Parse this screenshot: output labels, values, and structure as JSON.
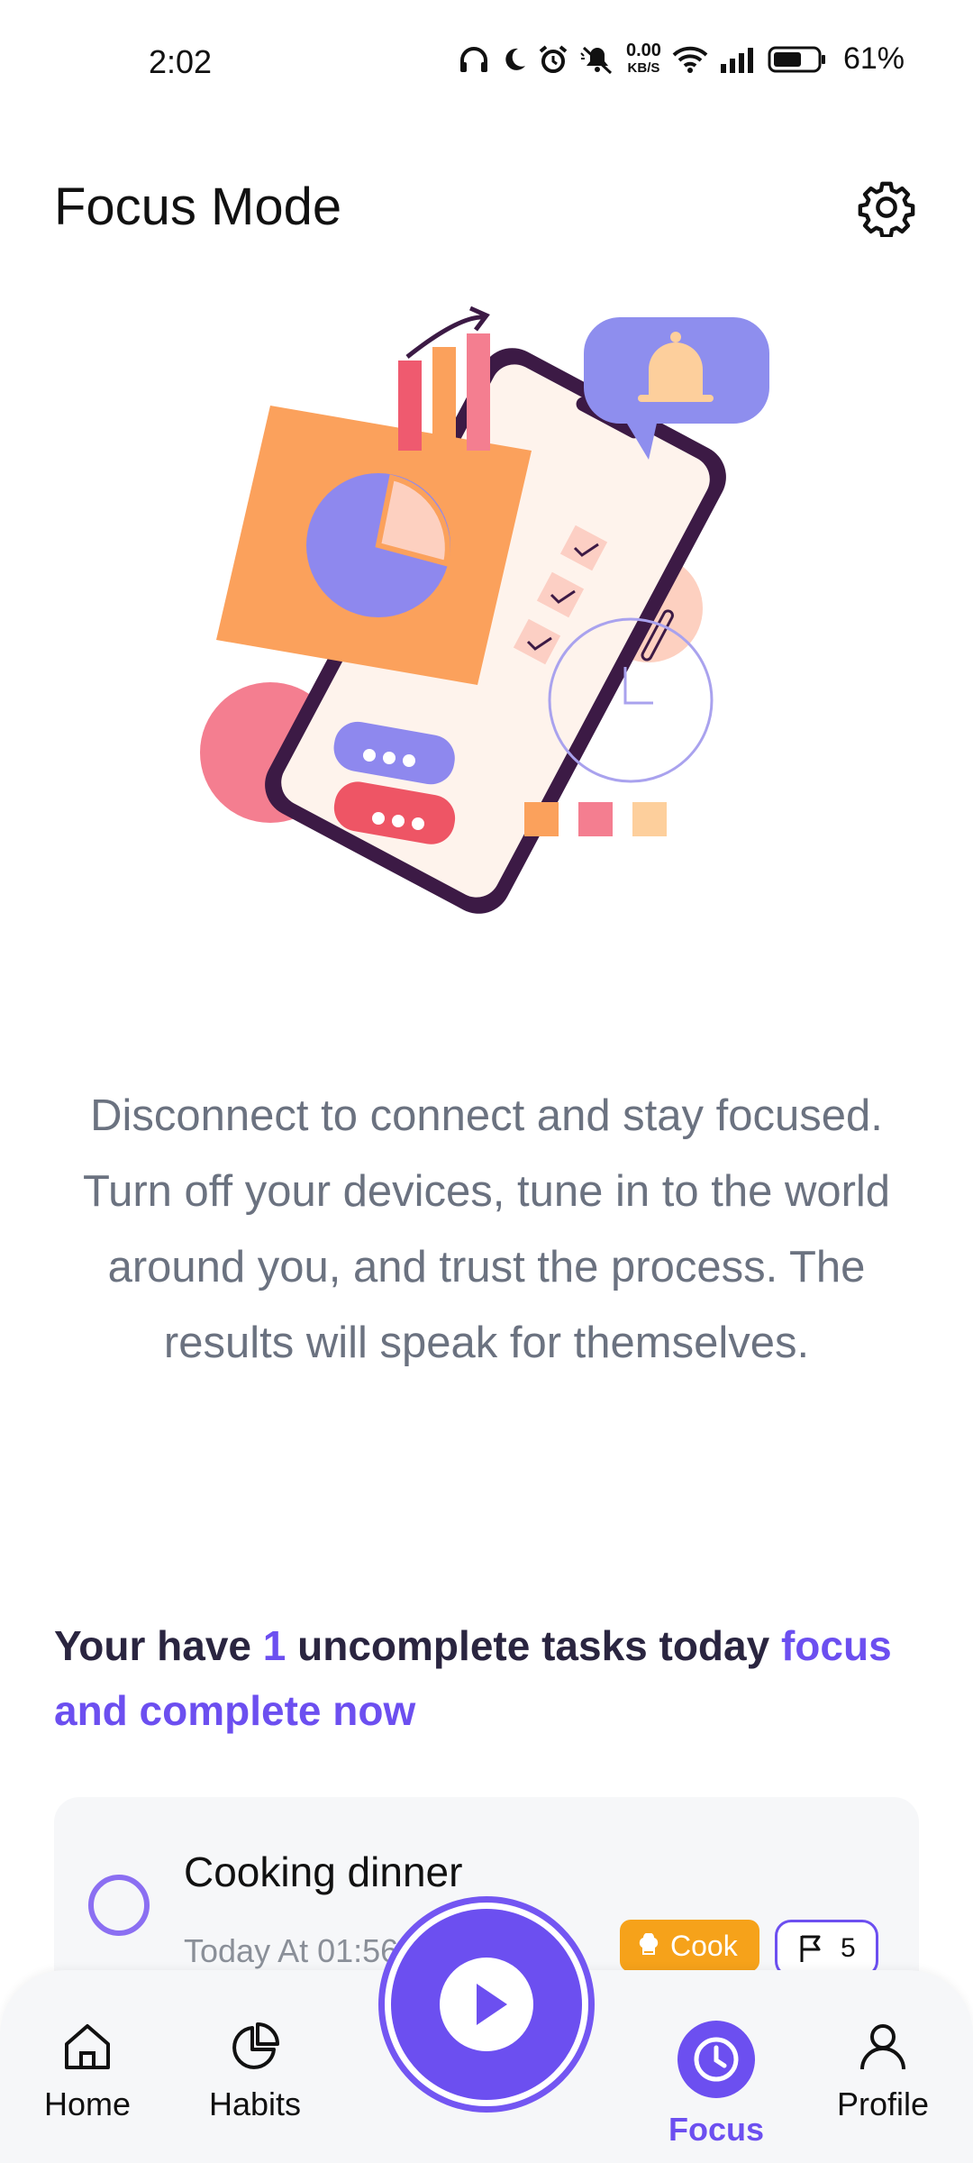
{
  "status_bar": {
    "time": "2:02",
    "net_speed_value": "0.00",
    "net_speed_unit": "KB/S",
    "battery_percent": "61%"
  },
  "header": {
    "title": "Focus Mode",
    "settings_icon": "gear-icon"
  },
  "quote": "Disconnect to connect and stay focused. Turn off your devices, tune in to the world around you, and trust the process. The results will speak for themselves.",
  "tasks_summary": {
    "prefix": "Your have ",
    "count": "1",
    "middle": " uncomplete tasks today ",
    "cta": "focus and complete now"
  },
  "task": {
    "title": "Cooking dinner",
    "time": "Today At 01:56",
    "tag_label": "Cook",
    "tag_icon": "chef-hat-icon",
    "priority_icon": "flag-icon",
    "priority_value": "5"
  },
  "bottom_nav": {
    "items": [
      {
        "label": "Home",
        "icon": "home-icon"
      },
      {
        "label": "Habits",
        "icon": "pie-chart-icon"
      },
      {
        "label": "Focus",
        "icon": "clock-icon",
        "active": true
      },
      {
        "label": "Profile",
        "icon": "user-icon"
      }
    ],
    "fab_icon": "play-icon"
  },
  "colors": {
    "accent": "#6c4ff0",
    "tag": "#f6a21a",
    "text_muted": "#6b7280"
  }
}
